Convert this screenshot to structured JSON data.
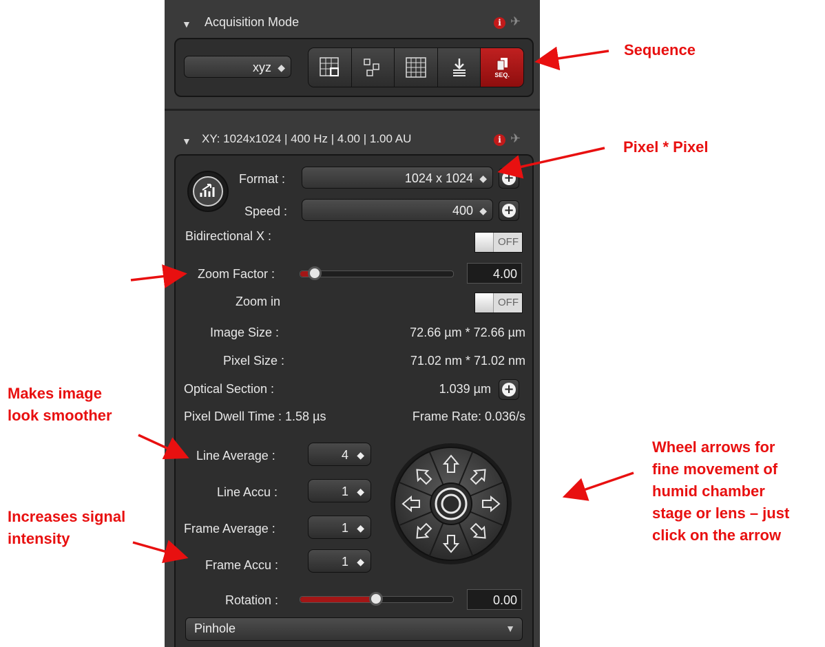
{
  "acquisition": {
    "header": "Acquisition Mode",
    "mode_value": "xyz"
  },
  "xy": {
    "header": "XY: 1024x1024 | 400 Hz | 4.00 | 1.00 AU",
    "format_label": "Format :",
    "format_value": "1024 x 1024",
    "speed_label": "Speed :",
    "speed_value": "400",
    "bidirectional_label": "Bidirectional X :",
    "bidirectional_state": "OFF",
    "zoom_factor_label": "Zoom Factor :",
    "zoom_factor_value": "4.00",
    "zoom_factor_level": 0.1,
    "zoom_in_label": "Zoom in",
    "zoom_in_state": "OFF",
    "image_size_label": "Image Size :",
    "image_size_value": "72.66 µm * 72.66 µm",
    "pixel_size_label": "Pixel Size :",
    "pixel_size_value": "71.02 nm * 71.02 nm",
    "optical_section_label": "Optical Section :",
    "optical_section_value": "1.039 µm",
    "pixel_dwell": "Pixel Dwell Time : 1.58 µs",
    "frame_rate": "Frame Rate: 0.036/s",
    "line_average_label": "Line Average :",
    "line_average_value": "4",
    "line_accu_label": "Line Accu :",
    "line_accu_value": "1",
    "frame_average_label": "Frame Average :",
    "frame_average_value": "1",
    "frame_accu_label": "Frame Accu :",
    "frame_accu_value": "1",
    "rotation_label": "Rotation :",
    "rotation_value": "0.00",
    "rotation_level": 0.5,
    "pinhole_label": "Pinhole"
  },
  "annotations": {
    "sequence": "Sequence",
    "pixel": "Pixel * Pixel",
    "smoother_1": "Makes image",
    "smoother_2": "look smoother",
    "signal_1": "Increases signal",
    "signal_2": "intensity",
    "wheel_1": "Wheel arrows for",
    "wheel_2": "fine movement of",
    "wheel_3": "humid chamber",
    "wheel_4": "stage or lens – just",
    "wheel_5": "click on the arrow"
  },
  "colors": {
    "annotation": "#e81010",
    "panel": "#3a3a3a",
    "accent_red": "#a31616"
  },
  "icons": [
    "info-icon",
    "pin-icon",
    "tile-grid-icon",
    "mosaic-icon",
    "grid-icon",
    "download-icon",
    "sequence-icon",
    "plus-icon",
    "roi-scan-icon",
    "direction-wheel"
  ]
}
